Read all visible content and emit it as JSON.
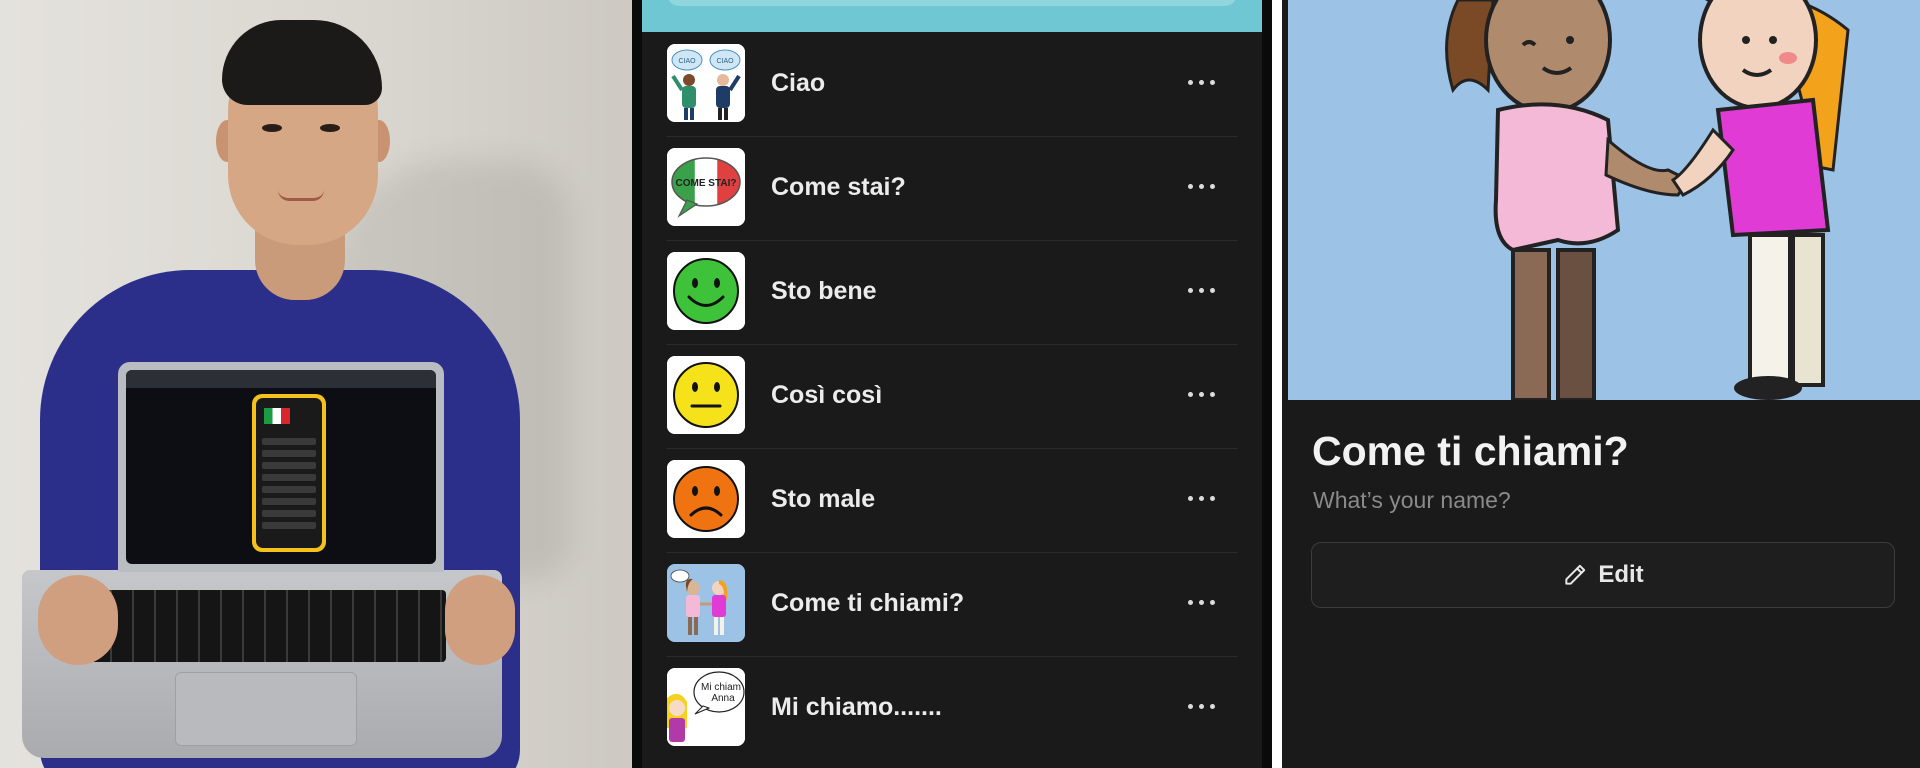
{
  "list": {
    "items": [
      {
        "label": "Ciao",
        "icon": "greeting-people-icon"
      },
      {
        "label": "Come stai?",
        "icon": "italian-flag-speech-bubble-icon"
      },
      {
        "label": "Sto bene",
        "icon": "happy-face-icon",
        "color": "#3ec23a"
      },
      {
        "label": "Così così",
        "icon": "neutral-face-icon",
        "color": "#f5e21b"
      },
      {
        "label": "Sto male",
        "icon": "sad-face-icon",
        "color": "#f07312"
      },
      {
        "label": "Come ti chiami?",
        "icon": "handshake-girls-icon"
      },
      {
        "label": "Mi chiamo.......",
        "icon": "girl-speech-bubble-icon"
      }
    ],
    "thumb_text": {
      "ciao_left": "CIAO",
      "ciao_right": "CIAO",
      "come_stai": "COME STAI?",
      "mi_chiamo": "Mi chiam",
      "anna": "Anna"
    }
  },
  "detail": {
    "title": "Come ti chiami?",
    "subtitle": "What’s your name?",
    "edit_label": "Edit",
    "edit_icon": "pencil-icon"
  },
  "colors": {
    "background": "#1a1a1a",
    "accent_top": "#6fc7d3",
    "illustration_sky": "#9cc2e6"
  }
}
